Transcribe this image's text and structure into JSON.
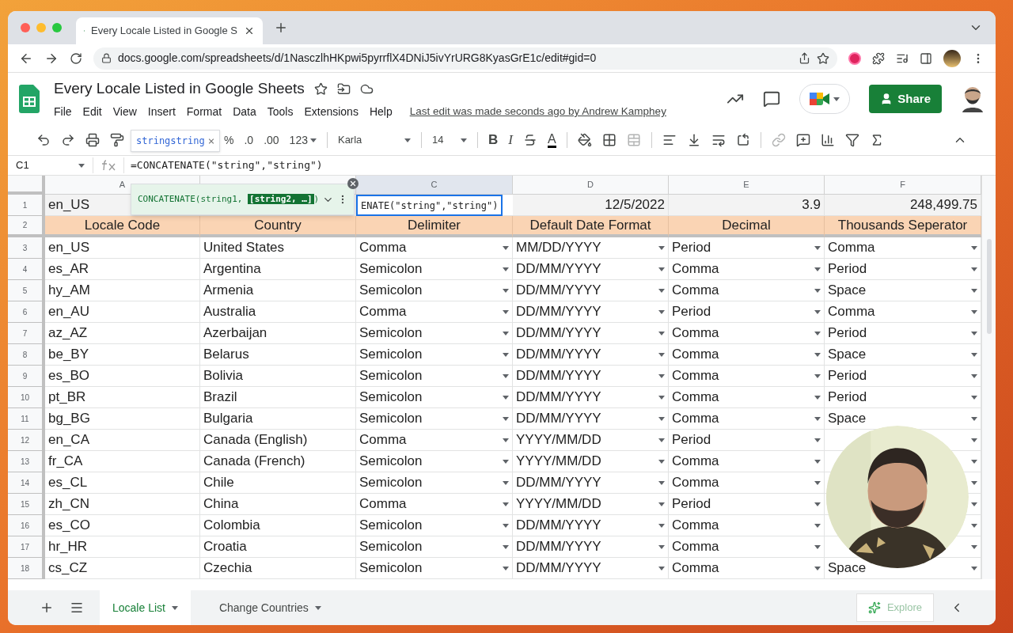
{
  "browser": {
    "tab_title": "Every Locale Listed in Google S",
    "address": "docs.google.com/spreadsheets/d/1NasczlhHKpwi5pyrrflX4DNiJ5ivYrURG8KyasGrE1c/edit#gid=0"
  },
  "doc": {
    "title": "Every Locale Listed in Google Sheets",
    "menu": [
      "File",
      "Edit",
      "View",
      "Insert",
      "Format",
      "Data",
      "Tools",
      "Extensions",
      "Help"
    ],
    "last_edit": "Last edit was made seconds ago by Andrew Kamphey",
    "share": "Share"
  },
  "toolbar": {
    "tooltip": "stringstring",
    "tooltip_close": "×",
    "percent": "%",
    "decrease_decimals": ".0",
    "increase_decimals": ".00",
    "number_format": "123",
    "font": "Karla",
    "font_size": "14",
    "bold": "B",
    "italic": "I",
    "text_color": "A"
  },
  "formula_bar": {
    "cell": "C1",
    "formula": "=CONCATENATE(\"string\",\"string\")"
  },
  "autocomplete": {
    "before": "CONCATENATE(string1, ",
    "highlight": "[string2, …]",
    "after": ")"
  },
  "columns": [
    {
      "label": "A",
      "selected": false
    },
    {
      "selected": false
    },
    {
      "label": "C",
      "selected": true
    },
    {
      "label": "D",
      "selected": false
    },
    {
      "label": "E",
      "selected": false
    },
    {
      "label": "F",
      "selected": false
    }
  ],
  "row1": {
    "number": "1",
    "a": "en_US",
    "c": "ENATE(\"string\",\"string\")",
    "d": "12/5/2022",
    "e": "3.9",
    "f": "248,499.75"
  },
  "header_row": {
    "number": "2",
    "cells": [
      "Locale Code",
      "Country",
      "Delimiter",
      "Default Date Format",
      "Decimal",
      "Thousands Seperator"
    ]
  },
  "rows": [
    {
      "number": "3",
      "cells": [
        "en_US",
        "United States",
        "Comma",
        "MM/DD/YYYY",
        "Period",
        "Comma"
      ]
    },
    {
      "number": "4",
      "cells": [
        "es_AR",
        "Argentina",
        "Semicolon",
        "DD/MM/YYYY",
        "Comma",
        "Period"
      ]
    },
    {
      "number": "5",
      "cells": [
        "hy_AM",
        "Armenia",
        "Semicolon",
        "DD/MM/YYYY",
        "Comma",
        "Space"
      ]
    },
    {
      "number": "6",
      "cells": [
        "en_AU",
        "Australia",
        "Comma",
        "DD/MM/YYYY",
        "Period",
        "Comma"
      ]
    },
    {
      "number": "7",
      "cells": [
        "az_AZ",
        "Azerbaijan",
        "Semicolon",
        "DD/MM/YYYY",
        "Comma",
        "Period"
      ]
    },
    {
      "number": "8",
      "cells": [
        "be_BY",
        "Belarus",
        "Semicolon",
        "DD/MM/YYYY",
        "Comma",
        "Space"
      ]
    },
    {
      "number": "9",
      "cells": [
        "es_BO",
        "Bolivia",
        "Semicolon",
        "DD/MM/YYYY",
        "Comma",
        "Period"
      ]
    },
    {
      "number": "10",
      "cells": [
        "pt_BR",
        "Brazil",
        "Semicolon",
        "DD/MM/YYYY",
        "Comma",
        "Period"
      ]
    },
    {
      "number": "11",
      "cells": [
        "bg_BG",
        "Bulgaria",
        "Semicolon",
        "DD/MM/YYYY",
        "Comma",
        "Space"
      ]
    },
    {
      "number": "12",
      "cells": [
        "en_CA",
        "Canada (English)",
        "Comma",
        "YYYY/MM/DD",
        "Period"
      ]
    },
    {
      "number": "13",
      "cells": [
        "fr_CA",
        "Canada (French)",
        "Semicolon",
        "YYYY/MM/DD",
        "Comma"
      ]
    },
    {
      "number": "14",
      "cells": [
        "es_CL",
        "Chile",
        "Semicolon",
        "DD/MM/YYYY",
        "Comma"
      ]
    },
    {
      "number": "15",
      "cells": [
        "zh_CN",
        "China",
        "Comma",
        "YYYY/MM/DD",
        "Period"
      ]
    },
    {
      "number": "16",
      "cells": [
        "es_CO",
        "Colombia",
        "Semicolon",
        "DD/MM/YYYY",
        "Comma"
      ]
    },
    {
      "number": "17",
      "cells": [
        "hr_HR",
        "Croatia",
        "Semicolon",
        "DD/MM/YYYY",
        "Comma"
      ]
    },
    {
      "number": "18",
      "cells": [
        "cs_CZ",
        "Czechia",
        "Semicolon",
        "DD/MM/YYYY",
        "Comma",
        "Space"
      ]
    }
  ],
  "sheet_tabs": [
    {
      "label": "Locale List",
      "selected": true
    },
    {
      "label": "Change Countries",
      "selected": false
    }
  ],
  "explore": "Explore"
}
